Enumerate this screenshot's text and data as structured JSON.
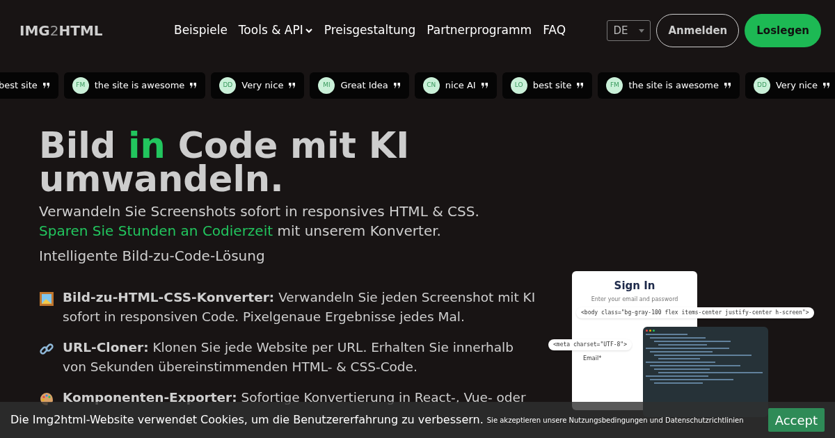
{
  "nav": {
    "logo": [
      {
        "text": "IMG",
        "light": false
      },
      {
        "text": "2",
        "light": true
      },
      {
        "text": "HTML",
        "light": false
      }
    ],
    "links": [
      {
        "label": "Beispiele",
        "dropdown": false
      },
      {
        "label": "Tools & API",
        "dropdown": true
      },
      {
        "label": "Preisgestaltung",
        "dropdown": false
      },
      {
        "label": "Partnerprogramm",
        "dropdown": false
      },
      {
        "label": "FAQ",
        "dropdown": false
      }
    ],
    "language": "DE",
    "login": "Anmelden",
    "cta": "Loslegen"
  },
  "testimonials": [
    {
      "text": "best site"
    },
    {
      "initials": "FM",
      "text": "the site is awesome"
    },
    {
      "initials": "DD",
      "text": "Very nice"
    },
    {
      "initials": "MI",
      "text": "Great Idea"
    },
    {
      "initials": "CN",
      "text": "nice AI"
    },
    {
      "initials": "LO",
      "text": "best site"
    },
    {
      "initials": "FM",
      "text": "the site is awesome"
    },
    {
      "initials": "DD",
      "text": "Very nice"
    }
  ],
  "hero": {
    "title": [
      {
        "text": "Bild ",
        "accent": false
      },
      {
        "text": "in",
        "accent": true
      },
      {
        "text": " Code mit KI umwandeln.",
        "accent": false
      }
    ],
    "subtitle": [
      {
        "text": "Verwandeln Sie Screenshots sofort in responsives HTML & CSS. ",
        "accent": false
      },
      {
        "text": "Sparen Sie Stunden an Codierzeit",
        "accent": true
      },
      {
        "text": " mit unserem Konverter.",
        "accent": false
      }
    ],
    "tagline": "Intelligente Bild-zu-Code-Lösung"
  },
  "features": [
    {
      "kind": "image",
      "text": "**Bild-zu-HTML-CSS-Konverter:** Verwandeln Sie jeden Screenshot mit KI sofort in responsiven Code. Pixelgenaue Ergebnisse jedes Mal."
    },
    {
      "kind": "link",
      "text": "**URL-Cloner:** Klonen Sie jede Website per URL. Erhalten Sie innerhalb von Sekunden übereinstimmenden HTML- & CSS-Code."
    },
    {
      "kind": "palette",
      "text": "**Komponenten-Exporter:** Sofortige Konvertierung in React-, Vue- oder"
    }
  ],
  "illustration": {
    "heading": "Sign In",
    "hint": "Enter your email and password",
    "code_top": "<body class=\"bg-gray-100 flex items-center justify-center h-screen\">",
    "code_left": "<meta charset=\"UTF-8\">",
    "email_label": "Email*"
  },
  "cookie_banner": {
    "text": "Die Img2html-Website verwendet Cookies, um die Benutzererfahrung zu verbessern.",
    "note": "Sie akzeptieren unsere Nutzungsbedingungen und Datenschutzrichtlinien",
    "button": "Accept"
  }
}
